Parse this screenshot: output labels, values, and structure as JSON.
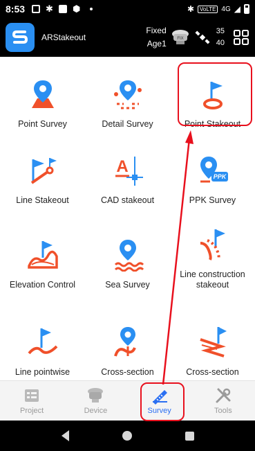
{
  "status_bar": {
    "time": "8:53",
    "network": "4G"
  },
  "app_bar": {
    "title": "ARStakeout",
    "fix_status": "Fixed",
    "age": "Age1",
    "sats_used": "35",
    "sats_visible": "40"
  },
  "colors": {
    "accent_orange": "#f0502a",
    "accent_blue": "#2a8ff2",
    "nav_active": "#2a6ff2",
    "annotation_red": "#e8101d"
  },
  "grid": {
    "items": [
      {
        "label": "Point Survey",
        "icon": "point-survey-icon"
      },
      {
        "label": "Detail Survey",
        "icon": "detail-survey-icon"
      },
      {
        "label": "Point Stakeout",
        "icon": "point-stakeout-icon"
      },
      {
        "label": "Line Stakeout",
        "icon": "line-stakeout-icon"
      },
      {
        "label": "CAD stakeout",
        "icon": "cad-stakeout-icon"
      },
      {
        "label": "PPK Survey",
        "icon": "ppk-survey-icon",
        "badge": "PPK"
      },
      {
        "label": "Elevation Control",
        "icon": "elevation-control-icon"
      },
      {
        "label": "Sea Survey",
        "icon": "sea-survey-icon"
      },
      {
        "label": "Line construction stakeout",
        "icon": "line-construction-stakeout-icon"
      },
      {
        "label": "Line pointwise",
        "icon": "line-pointwise-icon"
      },
      {
        "label": "Cross-section",
        "icon": "cross-section-icon"
      },
      {
        "label": "Cross-section",
        "icon": "cross-section-road-icon"
      }
    ]
  },
  "bottom_nav": {
    "items": [
      {
        "label": "Project",
        "icon": "project-icon",
        "active": false
      },
      {
        "label": "Device",
        "icon": "device-icon",
        "active": false
      },
      {
        "label": "Survey",
        "icon": "survey-icon",
        "active": true
      },
      {
        "label": "Tools",
        "icon": "tools-icon",
        "active": false
      }
    ]
  }
}
